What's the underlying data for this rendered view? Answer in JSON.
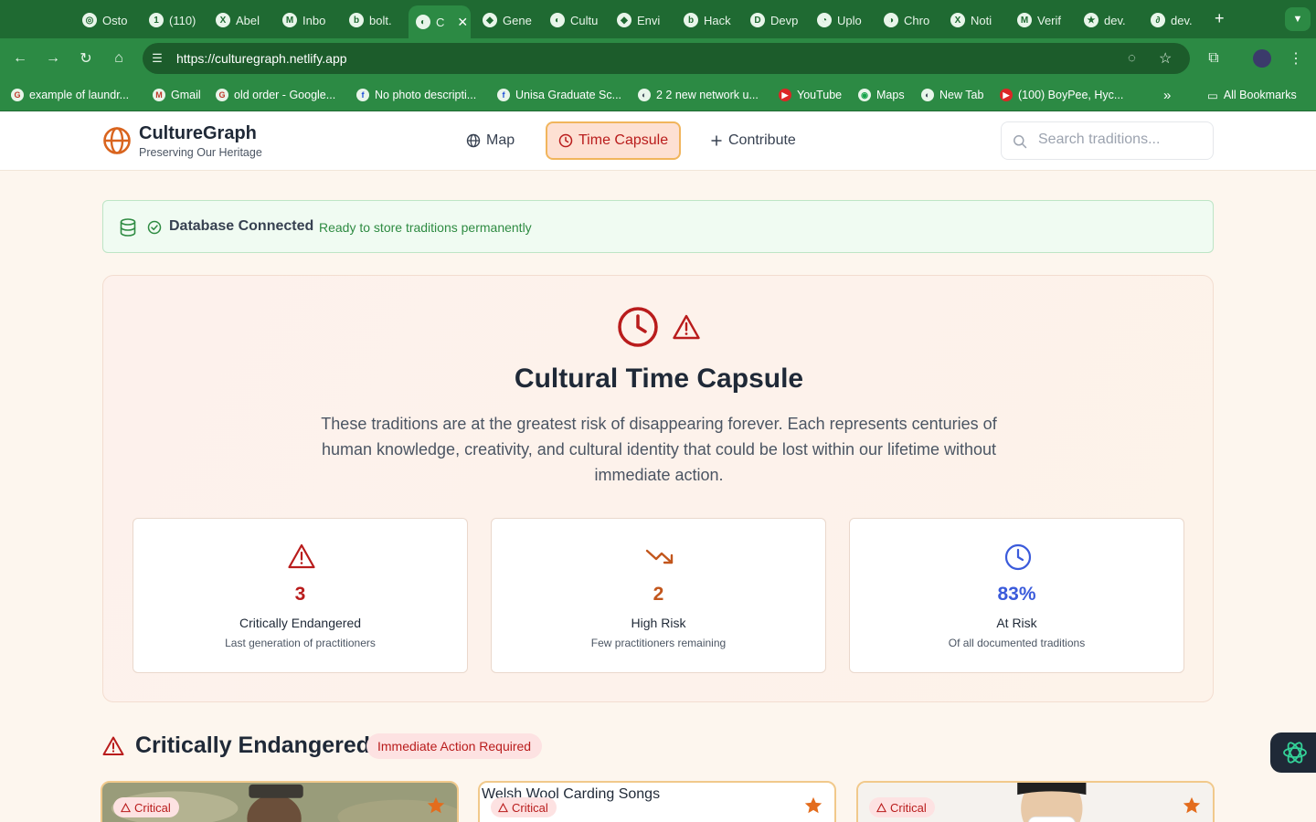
{
  "browser": {
    "tabs": [
      {
        "title": "Osto",
        "fav": "◎"
      },
      {
        "title": "(110)",
        "fav": "1"
      },
      {
        "title": "Abel",
        "fav": "X"
      },
      {
        "title": "Inbo",
        "fav": "M"
      },
      {
        "title": "bolt.",
        "fav": "b"
      },
      {
        "title": "C",
        "fav": "◐"
      },
      {
        "title": "Gene",
        "fav": "◆"
      },
      {
        "title": "Cultu",
        "fav": "◐"
      },
      {
        "title": "Envi",
        "fav": "◆"
      },
      {
        "title": "Hack",
        "fav": "b"
      },
      {
        "title": "Devp",
        "fav": "D"
      },
      {
        "title": "Uplo",
        "fav": "◔"
      },
      {
        "title": "Chro",
        "fav": "◑"
      },
      {
        "title": "Noti",
        "fav": "X"
      },
      {
        "title": "Verif",
        "fav": "M"
      },
      {
        "title": "dev.",
        "fav": "★"
      },
      {
        "title": "dev.",
        "fav": "∂"
      }
    ],
    "url": "https://culturegraph.netlify.app",
    "bookmarks": [
      {
        "label": "example of laundr...",
        "fav": "G"
      },
      {
        "label": "Gmail",
        "fav": "M"
      },
      {
        "label": "old order - Google...",
        "fav": "G"
      },
      {
        "label": "No photo descripti...",
        "fav": "f"
      },
      {
        "label": "Unisa Graduate Sc...",
        "fav": "f"
      },
      {
        "label": "2 2 new network u...",
        "fav": "◐"
      },
      {
        "label": "YouTube",
        "fav": "▶"
      },
      {
        "label": "Maps",
        "fav": "◉"
      },
      {
        "label": "New Tab",
        "fav": "◐"
      },
      {
        "label": "(100) BoyPee, Hyc...",
        "fav": "▶"
      }
    ],
    "all_bookmarks": "All Bookmarks"
  },
  "header": {
    "brand": "CultureGraph",
    "tagline": "Preserving Our Heritage",
    "nav": {
      "map": "Map",
      "time_capsule": "Time Capsule",
      "contribute": "Contribute"
    },
    "search_placeholder": "Search traditions..."
  },
  "db_status": {
    "title": "Database Connected",
    "subtitle": "Ready to store traditions permanently"
  },
  "capsule": {
    "title": "Cultural Time Capsule",
    "description": "These traditions are at the greatest risk of disappearing forever. Each represents centuries of human knowledge, creativity, and cultural identity that could be lost within our lifetime without immediate action.",
    "stats": [
      {
        "value": "3",
        "label": "Critically Endangered",
        "sub": "Last generation of practitioners",
        "color": "#b91c1c"
      },
      {
        "value": "2",
        "label": "High Risk",
        "sub": "Few practitioners remaining",
        "color": "#c2561c"
      },
      {
        "value": "83%",
        "label": "At Risk",
        "sub": "Of all documented traditions",
        "color": "#3b5bdb"
      }
    ]
  },
  "section": {
    "title": "Critically Endangered",
    "badge": "Immediate Action Required"
  },
  "cards": [
    {
      "badge": "Critical",
      "alt": ""
    },
    {
      "badge": "Critical",
      "alt": "Welsh Wool Carding Songs"
    },
    {
      "badge": "Critical",
      "alt": ""
    }
  ],
  "colors": {
    "accent": "#d9641e",
    "danger": "#b91c1c",
    "chrome": "#2c8a44"
  }
}
